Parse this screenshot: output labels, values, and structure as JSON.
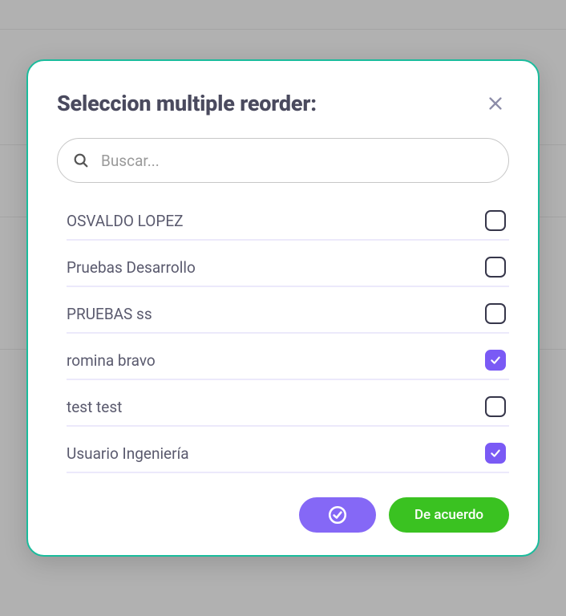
{
  "dialog": {
    "title": "Seleccion multiple reorder:",
    "search_placeholder": "Buscar...",
    "confirm_label": "De acuerdo"
  },
  "items": [
    {
      "label": "OSVALDO LOPEZ",
      "checked": false
    },
    {
      "label": "Pruebas Desarrollo",
      "checked": false
    },
    {
      "label": "PRUEBAS ss",
      "checked": false
    },
    {
      "label": "romina bravo",
      "checked": true
    },
    {
      "label": "test test",
      "checked": false
    },
    {
      "label": "Usuario Ingeniería",
      "checked": true
    }
  ],
  "colors": {
    "accent": "#7a5af5",
    "ok": "#3ac221",
    "dialog_border": "#1abc9c"
  }
}
